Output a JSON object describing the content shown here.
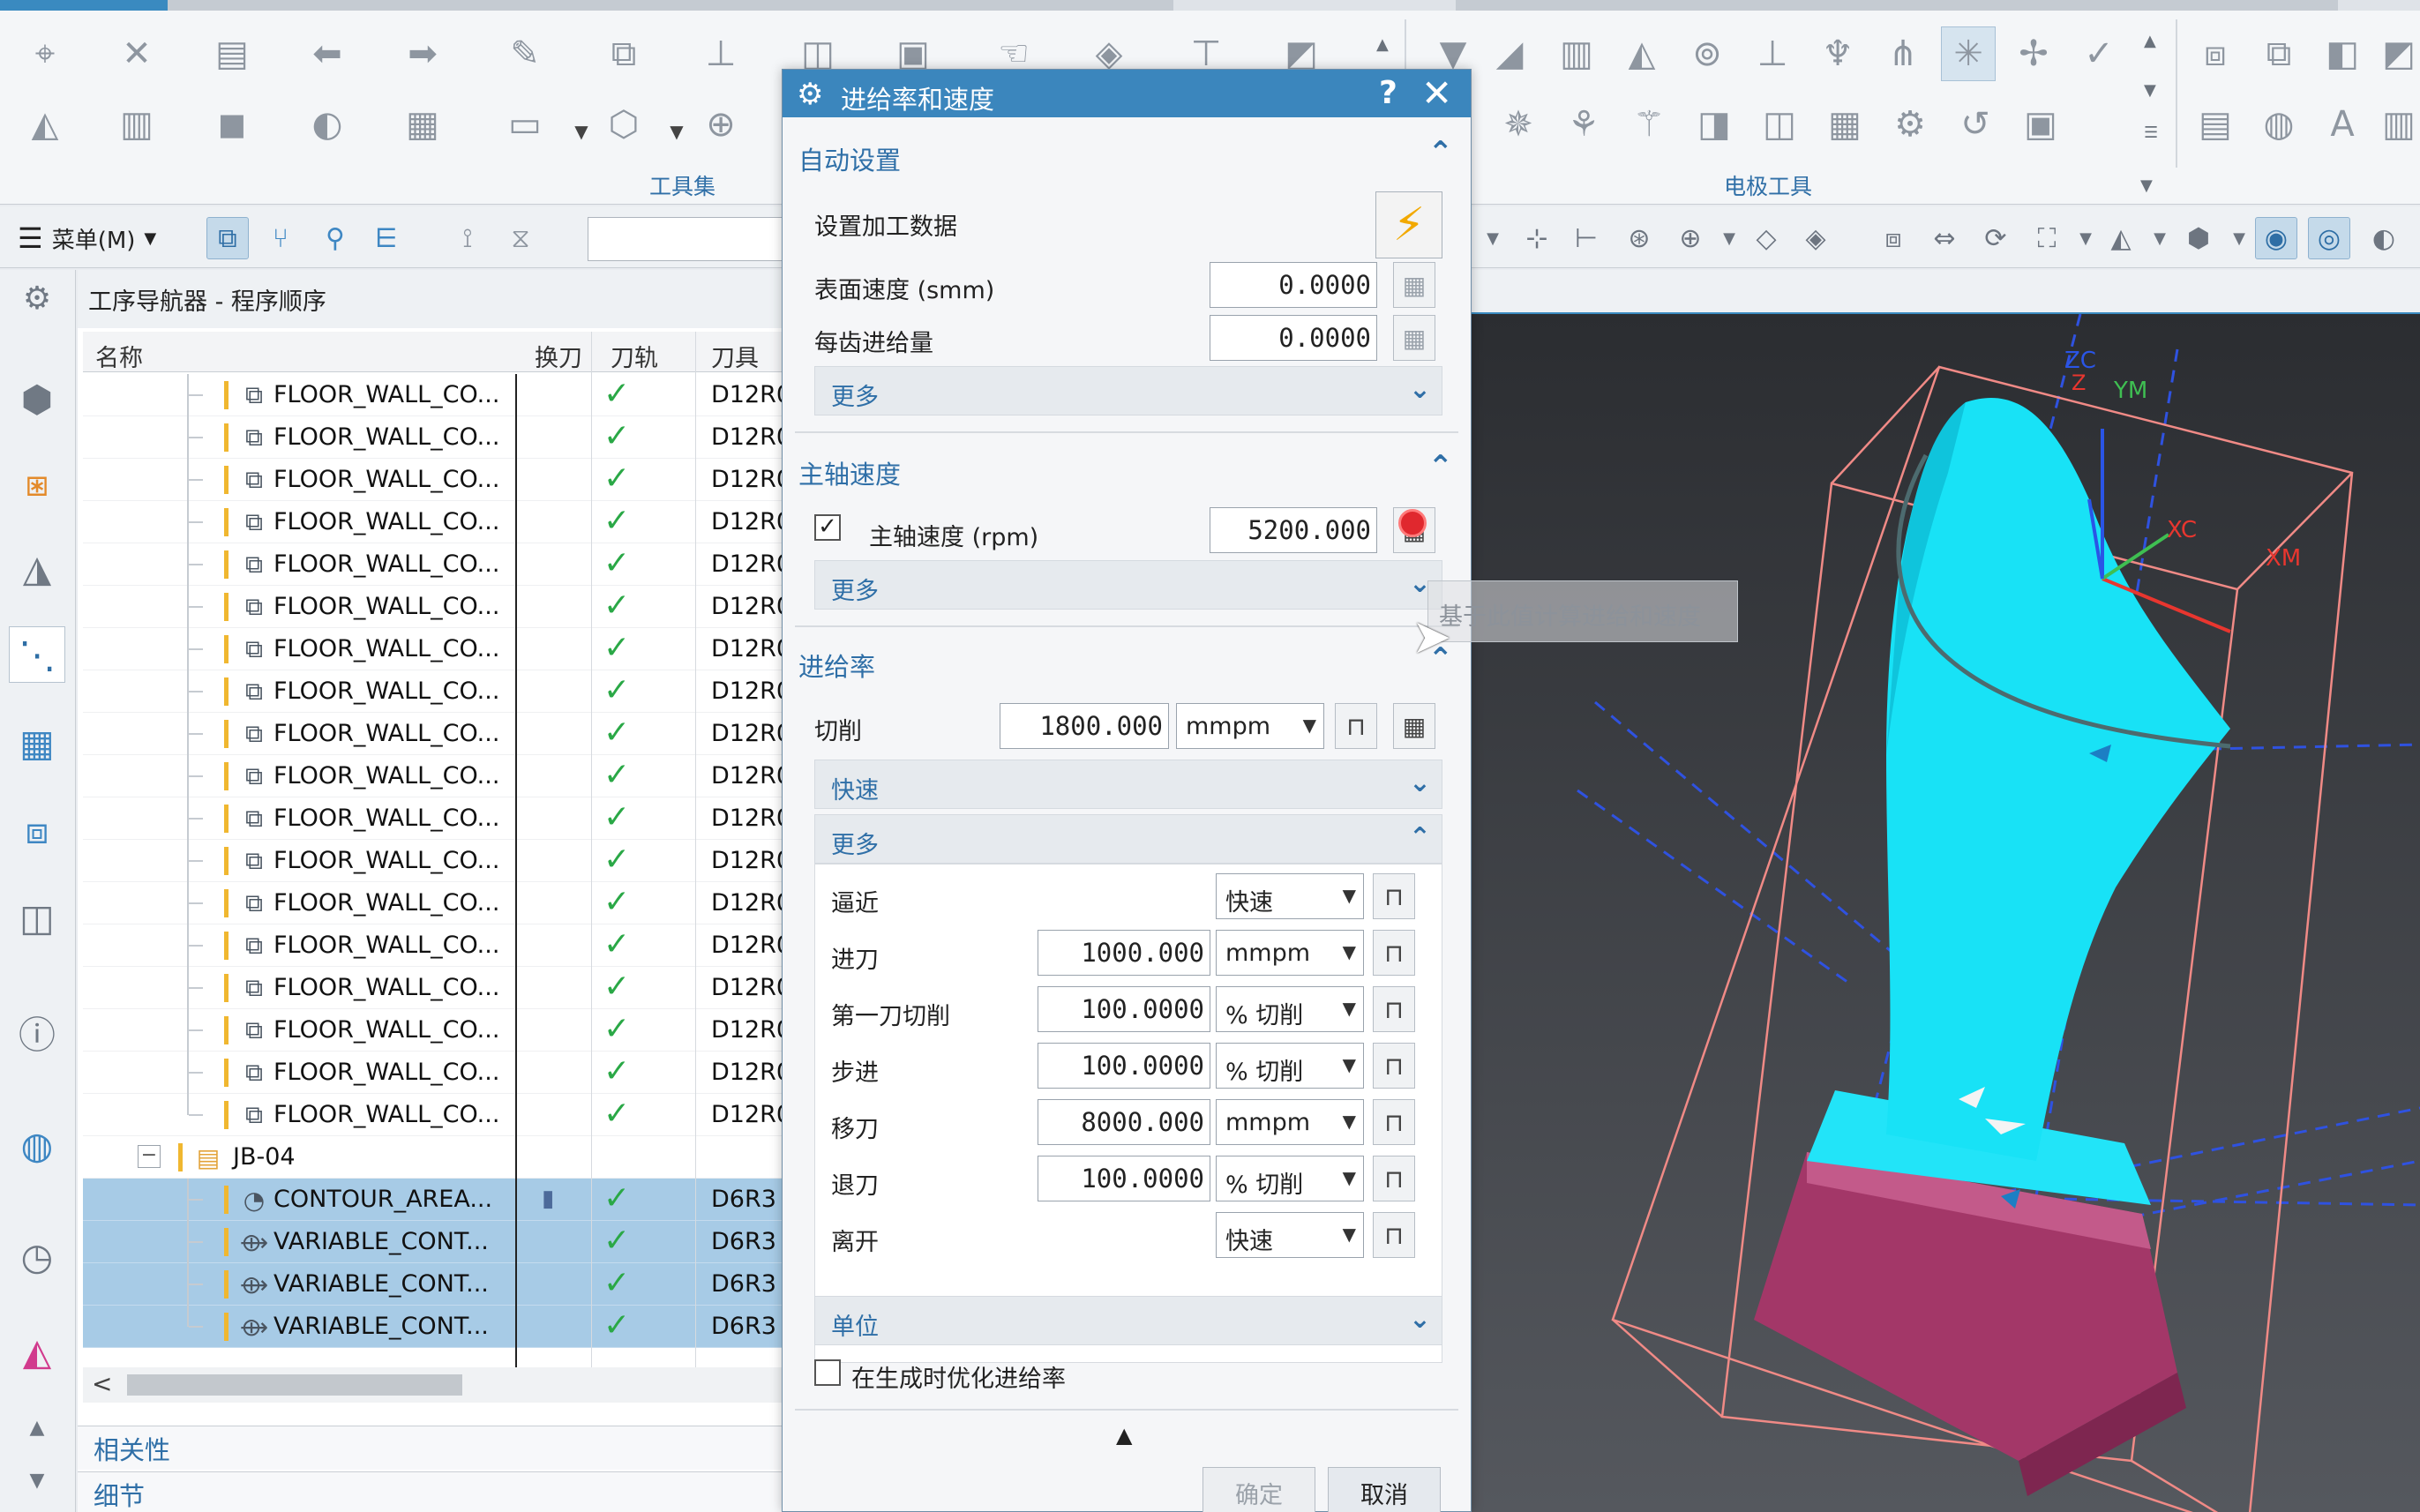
{
  "ribbon": {
    "group_left_label": "工具集",
    "group_right_label": "电极工具"
  },
  "toolbar": {
    "menu_label": "菜单(M)"
  },
  "navigator": {
    "title": "工序导航器 - 程序顺序",
    "columns": [
      "名称",
      "换刀",
      "刀轨",
      "刀具"
    ],
    "rows": [
      {
        "name": "FLOOR_WALL_CO...",
        "tool": "D12R0",
        "check": "✓"
      },
      {
        "name": "FLOOR_WALL_CO...",
        "tool": "D12R0",
        "check": "✓"
      },
      {
        "name": "FLOOR_WALL_CO...",
        "tool": "D12R0",
        "check": "✓"
      },
      {
        "name": "FLOOR_WALL_CO...",
        "tool": "D12R0",
        "check": "✓"
      },
      {
        "name": "FLOOR_WALL_CO...",
        "tool": "D12R0",
        "check": "✓"
      },
      {
        "name": "FLOOR_WALL_CO...",
        "tool": "D12R0",
        "check": "✓"
      },
      {
        "name": "FLOOR_WALL_CO...",
        "tool": "D12R0",
        "check": "✓"
      },
      {
        "name": "FLOOR_WALL_CO...",
        "tool": "D12R0",
        "check": "✓"
      },
      {
        "name": "FLOOR_WALL_CO...",
        "tool": "D12R0",
        "check": "✓"
      },
      {
        "name": "FLOOR_WALL_CO...",
        "tool": "D12R0",
        "check": "✓"
      },
      {
        "name": "FLOOR_WALL_CO...",
        "tool": "D12R0",
        "check": "✓"
      },
      {
        "name": "FLOOR_WALL_CO...",
        "tool": "D12R0",
        "check": "✓"
      },
      {
        "name": "FLOOR_WALL_CO...",
        "tool": "D12R0",
        "check": "✓"
      },
      {
        "name": "FLOOR_WALL_CO...",
        "tool": "D12R0",
        "check": "✓"
      },
      {
        "name": "FLOOR_WALL_CO...",
        "tool": "D12R0",
        "check": "✓"
      },
      {
        "name": "FLOOR_WALL_CO...",
        "tool": "D12R0",
        "check": "✓"
      },
      {
        "name": "FLOOR_WALL_CO...",
        "tool": "D12R0",
        "check": "✓"
      },
      {
        "name": "FLOOR_WALL_CO...",
        "tool": "D12R0",
        "check": "✓"
      }
    ],
    "group": {
      "name": "JB-04",
      "expander": "−"
    },
    "group_rows": [
      {
        "name": "CONTOUR_AREA...",
        "tool": "D6R3",
        "check": "✓"
      },
      {
        "name": "VARIABLE_CONT...",
        "tool": "D6R3",
        "check": "✓"
      },
      {
        "name": "VARIABLE_CONT...",
        "tool": "D6R3",
        "check": "✓"
      },
      {
        "name": "VARIABLE_CONT...",
        "tool": "D6R3",
        "check": "✓"
      }
    ],
    "scroll_left": "<",
    "section_relevance": "相关性",
    "section_detail": "细节"
  },
  "dialog": {
    "title": "进给率和速度",
    "help": "?",
    "close": "✕",
    "auto": {
      "header": "自动设置",
      "set_data_label": "设置加工数据",
      "surface_speed_label": "表面速度 (smm)",
      "surface_speed_value": "0.0000",
      "feed_per_tooth_label": "每齿进给量",
      "feed_per_tooth_value": "0.0000",
      "more_label": "更多"
    },
    "spindle": {
      "header": "主轴速度",
      "checkbox_mark": "✓",
      "speed_label": "主轴速度 (rpm)",
      "speed_value": "5200.000",
      "more_label": "更多"
    },
    "feed": {
      "header": "进给率",
      "cut_label": "切削",
      "cut_value": "1800.000",
      "cut_unit": "mmpm",
      "rapid_label": "快速",
      "more_label": "更多",
      "items": [
        {
          "label": "逼近",
          "value": "",
          "unit": "快速"
        },
        {
          "label": "进刀",
          "value": "1000.000",
          "unit": "mmpm"
        },
        {
          "label": "第一刀切削",
          "value": "100.0000",
          "unit": "% 切削"
        },
        {
          "label": "步进",
          "value": "100.0000",
          "unit": "% 切削"
        },
        {
          "label": "移刀",
          "value": "8000.000",
          "unit": "mmpm"
        },
        {
          "label": "退刀",
          "value": "100.0000",
          "unit": "% 切削"
        },
        {
          "label": "离开",
          "value": "",
          "unit": "快速"
        }
      ],
      "units_label": "单位",
      "optimize_label": "在生成时优化进给率"
    },
    "ok_label": "确定",
    "cancel_label": "取消"
  },
  "tooltip": "基于此值计算进给和速度",
  "viewport": {
    "axis_zc": "ZC",
    "axis_ym": "YM",
    "axis_xc": "XC",
    "axis_xm": "XM",
    "axis_z": "Z"
  },
  "colors": {
    "accent_blue": "#3b86bd",
    "part_cyan": "#1ee3f5",
    "base_magenta": "#b23f72",
    "check_green": "#2aa846"
  }
}
